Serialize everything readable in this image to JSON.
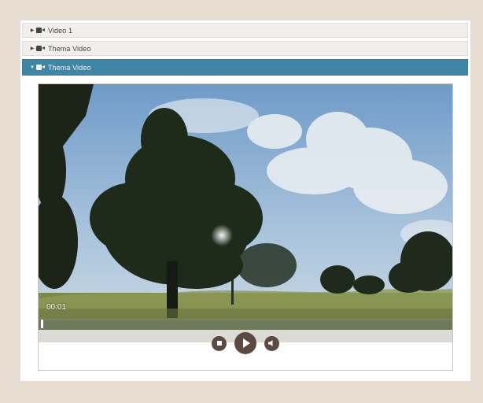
{
  "accordion": {
    "items": [
      {
        "label": "Video 1",
        "open": false
      },
      {
        "label": "Thema Video",
        "open": false
      },
      {
        "label": "Thema Video",
        "open": true
      }
    ]
  },
  "player": {
    "timecode": "00:01",
    "progress": 0.005,
    "controls": [
      "stop-icon",
      "play-icon",
      "volume-icon"
    ]
  },
  "colors": {
    "background": "#e6dcd0",
    "accent": "#3f86a6",
    "control": "#5a4a42"
  }
}
